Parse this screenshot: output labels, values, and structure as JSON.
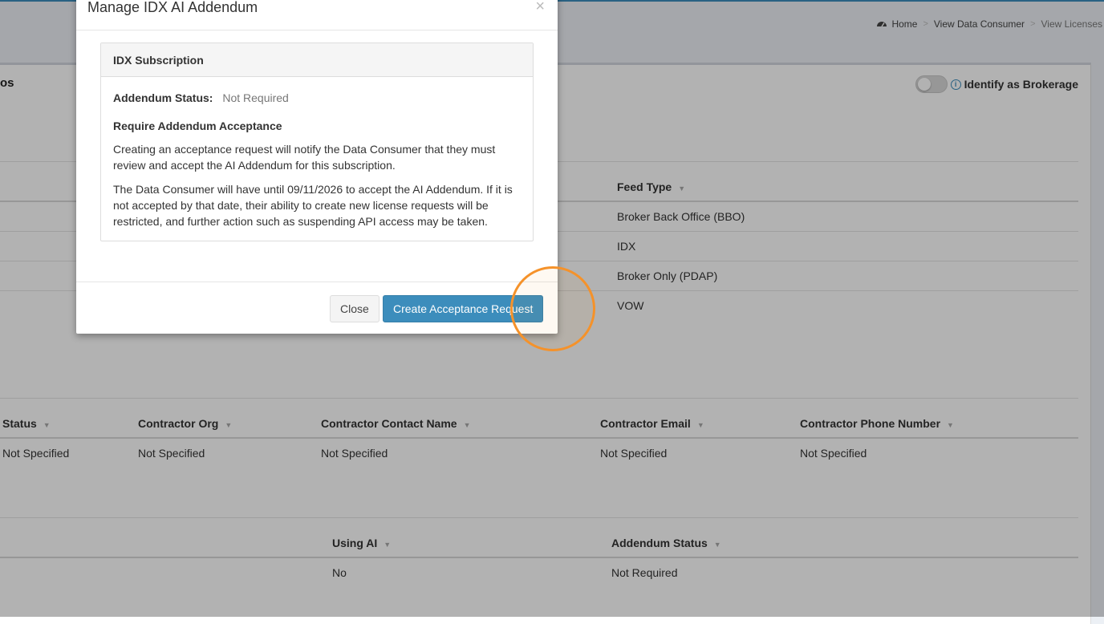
{
  "breadcrumb": {
    "items": [
      "Home",
      "View Data Consumer",
      "View Licenses"
    ],
    "icon": "dashboard-icon"
  },
  "page": {
    "title_fragment": "os",
    "brokerage_label": "Identify as Brokerage",
    "brokerage_toggle": "off",
    "info_glyph": "i"
  },
  "feeds_table": {
    "header": "Feed Type",
    "rows": [
      "Broker Back Office (BBO)",
      "IDX",
      "Broker Only (PDAP)",
      "VOW"
    ]
  },
  "contractor_table": {
    "headers": [
      "Status",
      "Contractor Org",
      "Contractor Contact Name",
      "Contractor Email",
      "Contractor Phone Number"
    ],
    "row": [
      "Not Specified",
      "Not Specified",
      "Not Specified",
      "Not Specified",
      "Not Specified"
    ]
  },
  "ai_table": {
    "headers": [
      "Using AI",
      "Addendum Status"
    ],
    "row": [
      "No",
      "Not Required"
    ]
  },
  "modal": {
    "title": "Manage IDX AI Addendum",
    "close_glyph": "×",
    "box_title": "IDX Subscription",
    "status_label": "Addendum Status:",
    "status_value": "Not Required",
    "section_heading": "Require Addendum Acceptance",
    "paragraph_1": "Creating an acceptance request will notify the Data Consumer that they must review and accept the AI Addendum for this subscription.",
    "paragraph_2": "The Data Consumer will have until 09/11/2026 to accept the AI Addendum. If it is not accepted by that date, their ability to create new license requests will be restricted, and further action such as suspending API access may be taken.",
    "close_button": "Close",
    "primary_button": "Create Acceptance Request"
  },
  "colors": {
    "primary": "#3c8dbc",
    "highlight_ring": "#f5922a"
  }
}
